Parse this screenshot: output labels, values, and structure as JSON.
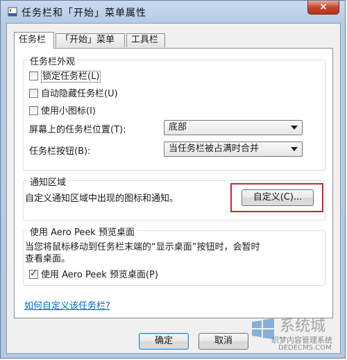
{
  "window": {
    "title": "任务栏和「开始」菜单属性",
    "close_label": "×"
  },
  "tabs": [
    {
      "label": "任务栏"
    },
    {
      "label": "「开始」菜单"
    },
    {
      "label": "工具栏"
    }
  ],
  "appearance": {
    "group_title": "任务栏外观",
    "lock_label": "锁定任务栏(L)",
    "autohide_label": "自动隐藏任务栏(U)",
    "small_icons_label": "使用小图标(I)",
    "position_label": "屏幕上的任务栏位置(T):",
    "position_value": "底部",
    "buttons_label": "任务栏按钮(B):",
    "buttons_value": "当任务栏被占满时合并"
  },
  "notification": {
    "group_title": "通知区域",
    "description": "自定义通知区域中出现的图标和通知。",
    "customize_label": "自定义(C)..."
  },
  "aero": {
    "group_title": "使用 Aero Peek 预览桌面",
    "description_line1": "当您将鼠标移动到任务栏末端的“显示桌面”按钮时，会暂时",
    "description_line2": "查看桌面。",
    "checkbox_label": "使用 Aero Peek 预览桌面(P)"
  },
  "help_link": "如何自定义该任务栏?",
  "footer": {
    "ok_label": "确定",
    "cancel_label": "取消"
  },
  "watermark": {
    "brand": "系统城",
    "line1": "织梦内容管理系统",
    "line2": "DEDECMS.COM"
  },
  "colors": {
    "highlight_red": "#c0282d",
    "link_blue": "#0066cc",
    "close_red": "#c7452c"
  }
}
